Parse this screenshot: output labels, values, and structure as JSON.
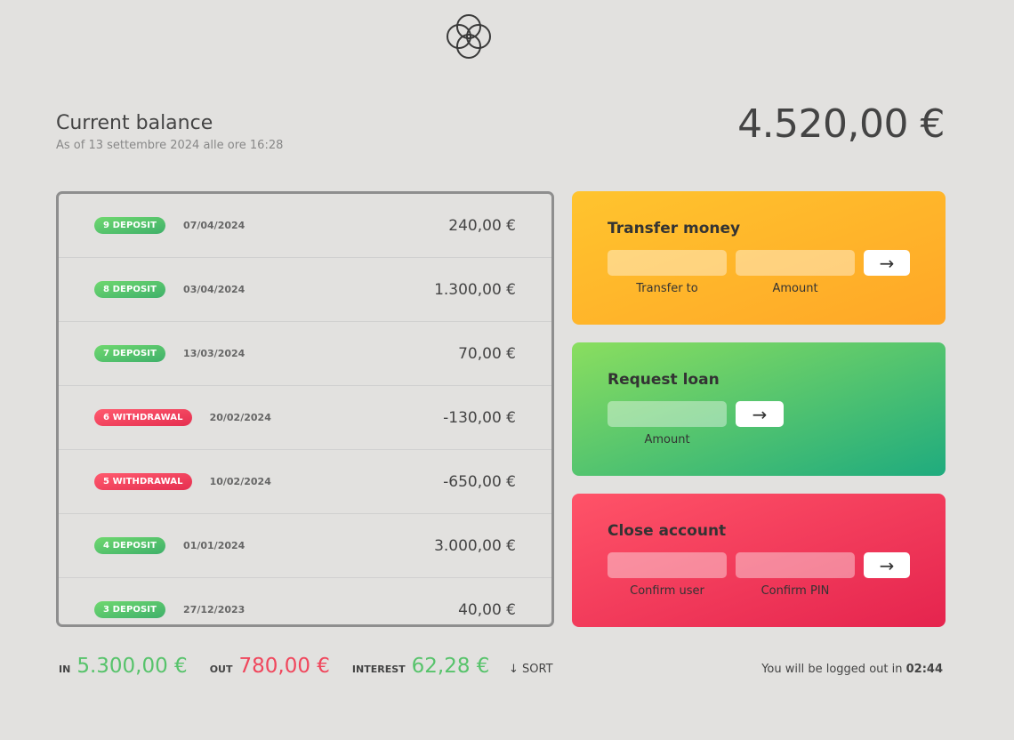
{
  "balance": {
    "title": "Current balance",
    "date_prefix": "As of",
    "date": "13 settembre 2024 alle ore 16:28",
    "value": "4.520,00 €"
  },
  "movements": [
    {
      "label": "9 deposit",
      "type": "deposit",
      "date": "07/04/2024",
      "value": "240,00 €"
    },
    {
      "label": "8 deposit",
      "type": "deposit",
      "date": "03/04/2024",
      "value": "1.300,00 €"
    },
    {
      "label": "7 deposit",
      "type": "deposit",
      "date": "13/03/2024",
      "value": "70,00 €"
    },
    {
      "label": "6 withdrawal",
      "type": "withdrawal",
      "date": "20/02/2024",
      "value": "-130,00 €"
    },
    {
      "label": "5 withdrawal",
      "type": "withdrawal",
      "date": "10/02/2024",
      "value": "-650,00 €"
    },
    {
      "label": "4 deposit",
      "type": "deposit",
      "date": "01/01/2024",
      "value": "3.000,00 €"
    },
    {
      "label": "3 deposit",
      "type": "deposit",
      "date": "27/12/2023",
      "value": "40,00 €"
    }
  ],
  "operations": {
    "transfer": {
      "title": "Transfer money",
      "field1": "Transfer to",
      "field2": "Amount",
      "button": "→"
    },
    "loan": {
      "title": "Request loan",
      "field1": "Amount",
      "button": "→"
    },
    "close": {
      "title": "Close account",
      "field1": "Confirm user",
      "field2": "Confirm PIN",
      "button": "→"
    }
  },
  "summary": {
    "in_label": "In",
    "in_value": "5.300,00 €",
    "out_label": "Out",
    "out_value": "780,00 €",
    "interest_label": "Interest",
    "interest_value": "62,28 €",
    "sort_label": "↓ SORT"
  },
  "logout": {
    "text": "You will be logged out in",
    "timer": "02:44"
  },
  "colors": {
    "background": "#e2e1df",
    "deposit": "#57c36b",
    "withdrawal": "#f0465c",
    "transfer_card": "#ffb52b",
    "loan_card": "#5dc96d",
    "close_card": "#f03c5b"
  },
  "icons": {
    "logo": "four-ring-logo-icon",
    "button_arrow": "arrow-right-icon"
  }
}
